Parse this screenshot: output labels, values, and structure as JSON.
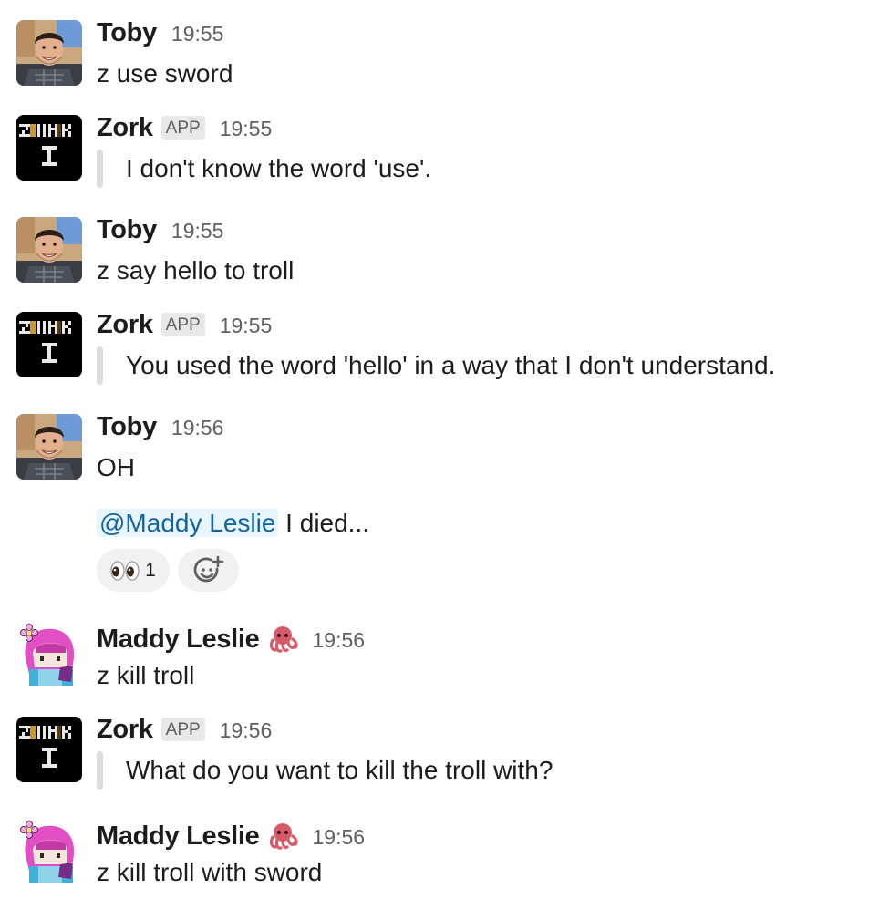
{
  "messages": [
    {
      "author": "Toby",
      "time": "19:55",
      "text": "z use sword"
    },
    {
      "author": "Zork",
      "badge": "APP",
      "time": "19:55",
      "text": "I don't know the word 'use'."
    },
    {
      "author": "Toby",
      "time": "19:55",
      "text": "z say hello to troll"
    },
    {
      "author": "Zork",
      "badge": "APP",
      "time": "19:55",
      "text": "You used the word 'hello' in a way that I don't understand."
    },
    {
      "author": "Toby",
      "time": "19:56",
      "text": "OH",
      "mention": "@Maddy Leslie",
      "followup": " I died...",
      "reaction_count": "1"
    },
    {
      "author": "Maddy Leslie",
      "time": "19:56",
      "text": "z kill troll"
    },
    {
      "author": "Zork",
      "badge": "APP",
      "time": "19:56",
      "text": "What do you want to kill the troll with?"
    },
    {
      "author": "Maddy Leslie",
      "time": "19:56",
      "text": "z kill troll with sword"
    }
  ],
  "icons": {
    "reaction_emoji": "eyes-icon",
    "add_reaction": "add-reaction-icon",
    "status_emoji": "octopus-icon"
  },
  "colors": {
    "mention_text": "#1264a3",
    "mention_bg": "#e8f5fa",
    "badge_bg": "#e8e8e8",
    "timestamp": "#616061"
  }
}
